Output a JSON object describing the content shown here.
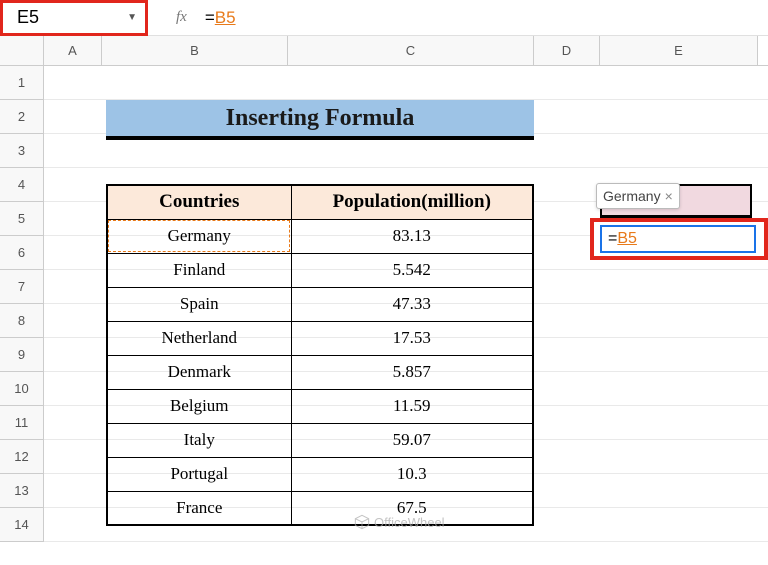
{
  "name_box": "E5",
  "fx_label": "fx",
  "formula_bar": {
    "prefix": "=",
    "ref": "B5"
  },
  "columns": {
    "A": "A",
    "B": "B",
    "C": "C",
    "D": "D",
    "E": "E"
  },
  "rows": [
    "1",
    "2",
    "3",
    "4",
    "5",
    "6",
    "7",
    "8",
    "9",
    "10",
    "11",
    "12",
    "13",
    "14"
  ],
  "title": "Inserting Formula",
  "table": {
    "headers": [
      "Countries",
      "Population(million)"
    ],
    "rows": [
      {
        "country": "Germany",
        "pop": "83.13"
      },
      {
        "country": "Finland",
        "pop": "5.542"
      },
      {
        "country": "Spain",
        "pop": "47.33"
      },
      {
        "country": "Netherland",
        "pop": "17.53"
      },
      {
        "country": "Denmark",
        "pop": "5.857"
      },
      {
        "country": "Belgium",
        "pop": "11.59"
      },
      {
        "country": "Italy",
        "pop": "59.07"
      },
      {
        "country": "Portugal",
        "pop": "10.3"
      },
      {
        "country": "France",
        "pop": "67.5"
      }
    ]
  },
  "tooltip": {
    "text": "Germany",
    "close": "×"
  },
  "active_cell": {
    "prefix": "=",
    "ref": "B5"
  },
  "watermark": "OfficeWheel"
}
